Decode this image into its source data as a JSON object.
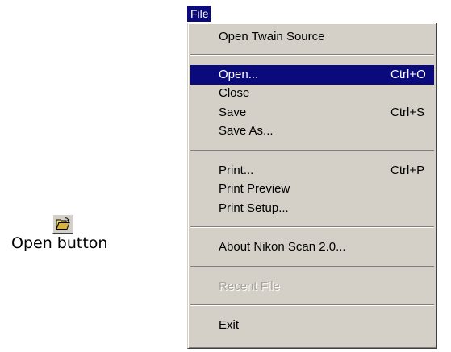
{
  "open_button": {
    "icon": "open-folder-icon",
    "caption": "Open button"
  },
  "menu": {
    "title": "File",
    "items": [
      {
        "label": "Open Twain Source",
        "shortcut": "",
        "highlighted": false,
        "disabled": false
      },
      {
        "label": "Open...",
        "shortcut": "Ctrl+O",
        "highlighted": true,
        "disabled": false
      },
      {
        "label": "Close",
        "shortcut": "",
        "highlighted": false,
        "disabled": false
      },
      {
        "label": "Save",
        "shortcut": "Ctrl+S",
        "highlighted": false,
        "disabled": false
      },
      {
        "label": "Save As...",
        "shortcut": "",
        "highlighted": false,
        "disabled": false
      },
      {
        "label": "Print...",
        "shortcut": "Ctrl+P",
        "highlighted": false,
        "disabled": false
      },
      {
        "label": "Print Preview",
        "shortcut": "",
        "highlighted": false,
        "disabled": false
      },
      {
        "label": "Print Setup...",
        "shortcut": "",
        "highlighted": false,
        "disabled": false
      },
      {
        "label": "About Nikon Scan 2.0...",
        "shortcut": "",
        "highlighted": false,
        "disabled": false
      },
      {
        "label": "Recent File",
        "shortcut": "",
        "highlighted": false,
        "disabled": true
      },
      {
        "label": "Exit",
        "shortcut": "",
        "highlighted": false,
        "disabled": false
      }
    ]
  },
  "colors": {
    "menu_face": "#d4d0c8",
    "highlight": "#0b0a7c",
    "highlight_text": "#ffffff",
    "disabled_text": "#a8a49c"
  }
}
